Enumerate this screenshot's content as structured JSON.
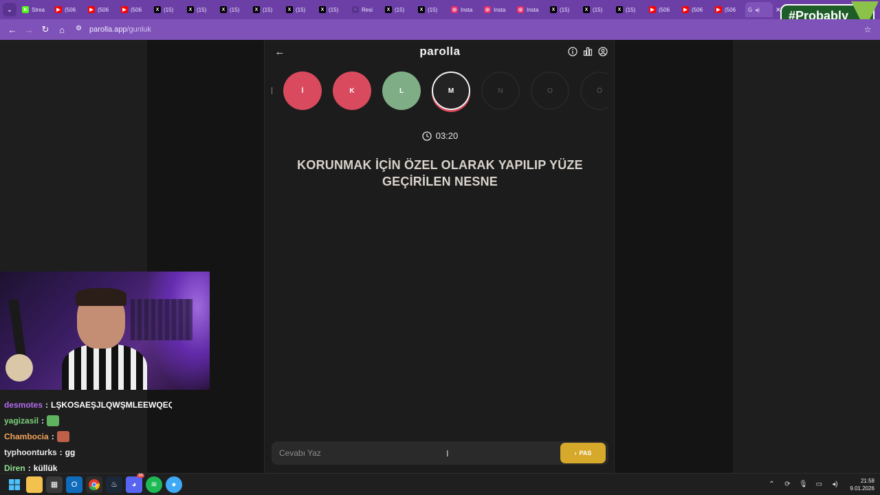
{
  "browser": {
    "tabs": [
      {
        "icon": "kick-icon",
        "label": "Strea",
        "color": "#53fc18",
        "glyph": "K"
      },
      {
        "icon": "youtube-icon",
        "label": "(506",
        "color": "#ff0000",
        "glyph": "▶"
      },
      {
        "icon": "youtube-icon",
        "label": "(506",
        "color": "#ff0000",
        "glyph": "▶"
      },
      {
        "icon": "youtube-icon",
        "label": "(506",
        "color": "#ff0000",
        "glyph": "▶"
      },
      {
        "icon": "x-icon",
        "label": "(15)",
        "color": "#000000",
        "glyph": "X"
      },
      {
        "icon": "x-icon",
        "label": "(15)",
        "color": "#000000",
        "glyph": "X"
      },
      {
        "icon": "x-icon",
        "label": "(15)",
        "color": "#000000",
        "glyph": "X"
      },
      {
        "icon": "x-icon",
        "label": "(15)",
        "color": "#000000",
        "glyph": "X"
      },
      {
        "icon": "x-icon",
        "label": "(15)",
        "color": "#000000",
        "glyph": "X"
      },
      {
        "icon": "x-icon",
        "label": "(15)",
        "color": "#000000",
        "glyph": "X"
      },
      {
        "icon": "blank-icon",
        "label": "Resi",
        "color": "#5a3390",
        "glyph": "·"
      },
      {
        "icon": "x-icon",
        "label": "(15)",
        "color": "#000000",
        "glyph": "X"
      },
      {
        "icon": "x-icon",
        "label": "(15)",
        "color": "#000000",
        "glyph": "X"
      },
      {
        "icon": "instagram-icon",
        "label": "Insta",
        "color": "#e1306c",
        "glyph": "◎"
      },
      {
        "icon": "instagram-icon",
        "label": "Insta",
        "color": "#e1306c",
        "glyph": "◎"
      },
      {
        "icon": "instagram-icon",
        "label": "Insta",
        "color": "#e1306c",
        "glyph": "◎"
      },
      {
        "icon": "x-icon",
        "label": "(15)",
        "color": "#000000",
        "glyph": "X"
      },
      {
        "icon": "x-icon",
        "label": "(15)",
        "color": "#000000",
        "glyph": "X"
      },
      {
        "icon": "x-icon",
        "label": "(15)",
        "color": "#000000",
        "glyph": "X"
      },
      {
        "icon": "youtube-icon",
        "label": "(506",
        "color": "#ff0000",
        "glyph": "▶"
      },
      {
        "icon": "youtube-icon",
        "label": "(506",
        "color": "#ff0000",
        "glyph": "▶"
      },
      {
        "icon": "youtube-icon",
        "label": "(506",
        "color": "#ff0000",
        "glyph": "▶"
      }
    ],
    "active_tab": {
      "label": "G"
    },
    "url_host": "parolla.app",
    "url_path": "/gunluk"
  },
  "overlay": {
    "brand": "#Probably"
  },
  "app": {
    "logo": "parolla",
    "letters": [
      {
        "char": "İ",
        "state": "wrong"
      },
      {
        "char": "K",
        "state": "wrong"
      },
      {
        "char": "L",
        "state": "right"
      },
      {
        "char": "M",
        "state": "current"
      },
      {
        "char": "N",
        "state": "pending"
      },
      {
        "char": "O",
        "state": "pending"
      },
      {
        "char": "Ö",
        "state": "pending"
      }
    ],
    "timer": "03:20",
    "question": "KORUNMAK İÇİN ÖZEL OLARAK YAPILIP YÜZE GEÇİRİLEN NESNE",
    "answer_placeholder": "Cevabı Yaz",
    "pass_label": "PAS",
    "colors": {
      "wrong": "#d94a5e",
      "right": "#7fae86",
      "pass": "#d6a92a"
    }
  },
  "chat": [
    {
      "user": "desmotes",
      "color": "#b46cf0",
      "msg": "LŞKOSAEŞJLQWŞMLEEWQEQW",
      "emote": null
    },
    {
      "user": "yagizasil",
      "color": "#7bd37b",
      "msg": "",
      "emote": "#5fb35f"
    },
    {
      "user": "Chambocia",
      "color": "#f2a35a",
      "msg": "",
      "emote": "#c0604a"
    },
    {
      "user": "typhoonturks",
      "color": "#e8e8e8",
      "msg": "gg",
      "emote": null
    },
    {
      "user": "Diren",
      "color": "#8fe08f",
      "msg": "küllük",
      "emote": null
    }
  ],
  "taskbar": {
    "time": "21:58",
    "date": "9.01.2026",
    "discord_badge": "99"
  }
}
